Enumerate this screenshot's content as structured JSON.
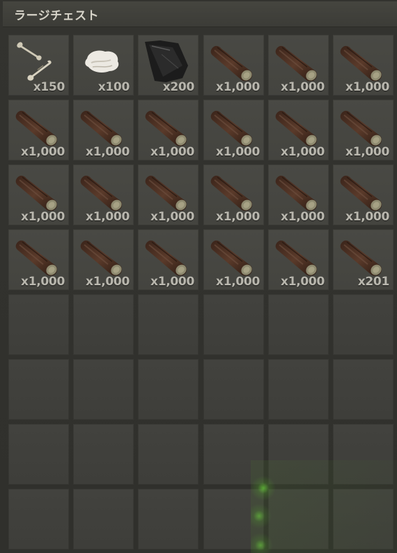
{
  "container": {
    "title": "ラージチェスト"
  },
  "slots": [
    {
      "item": "bone-fragments-icon",
      "qty": "x150"
    },
    {
      "item": "cloth-icon",
      "qty": "x100"
    },
    {
      "item": "leather-icon",
      "qty": "x200"
    },
    {
      "item": "wood-log-icon",
      "qty": "x1,000"
    },
    {
      "item": "wood-log-icon",
      "qty": "x1,000"
    },
    {
      "item": "wood-log-icon",
      "qty": "x1,000"
    },
    {
      "item": "wood-log-icon",
      "qty": "x1,000"
    },
    {
      "item": "wood-log-icon",
      "qty": "x1,000"
    },
    {
      "item": "wood-log-icon",
      "qty": "x1,000"
    },
    {
      "item": "wood-log-icon",
      "qty": "x1,000"
    },
    {
      "item": "wood-log-icon",
      "qty": "x1,000"
    },
    {
      "item": "wood-log-icon",
      "qty": "x1,000"
    },
    {
      "item": "wood-log-icon",
      "qty": "x1,000"
    },
    {
      "item": "wood-log-icon",
      "qty": "x1,000"
    },
    {
      "item": "wood-log-icon",
      "qty": "x1,000"
    },
    {
      "item": "wood-log-icon",
      "qty": "x1,000"
    },
    {
      "item": "wood-log-icon",
      "qty": "x1,000"
    },
    {
      "item": "wood-log-icon",
      "qty": "x1,000"
    },
    {
      "item": "wood-log-icon",
      "qty": "x1,000"
    },
    {
      "item": "wood-log-icon",
      "qty": "x1,000"
    },
    {
      "item": "wood-log-icon",
      "qty": "x1,000"
    },
    {
      "item": "wood-log-icon",
      "qty": "x1,000"
    },
    {
      "item": "wood-log-icon",
      "qty": "x1,000"
    },
    {
      "item": "wood-log-icon",
      "qty": "x201"
    },
    {
      "item": "",
      "qty": ""
    },
    {
      "item": "",
      "qty": ""
    },
    {
      "item": "",
      "qty": ""
    },
    {
      "item": "",
      "qty": ""
    },
    {
      "item": "",
      "qty": ""
    },
    {
      "item": "",
      "qty": ""
    },
    {
      "item": "",
      "qty": ""
    },
    {
      "item": "",
      "qty": ""
    },
    {
      "item": "",
      "qty": ""
    },
    {
      "item": "",
      "qty": ""
    },
    {
      "item": "",
      "qty": ""
    },
    {
      "item": "",
      "qty": ""
    },
    {
      "item": "",
      "qty": ""
    },
    {
      "item": "",
      "qty": ""
    },
    {
      "item": "",
      "qty": ""
    },
    {
      "item": "",
      "qty": ""
    },
    {
      "item": "",
      "qty": ""
    },
    {
      "item": "",
      "qty": ""
    },
    {
      "item": "",
      "qty": ""
    },
    {
      "item": "",
      "qty": ""
    },
    {
      "item": "",
      "qty": ""
    },
    {
      "item": "",
      "qty": ""
    },
    {
      "item": "",
      "qty": ""
    },
    {
      "item": "",
      "qty": ""
    }
  ],
  "colors": {
    "panel_bg": "#30302c",
    "slot_bg": "#464641",
    "qty_text": "#b9b7ae",
    "title_text": "#d6d3c8",
    "glow": "#78ff3c"
  }
}
